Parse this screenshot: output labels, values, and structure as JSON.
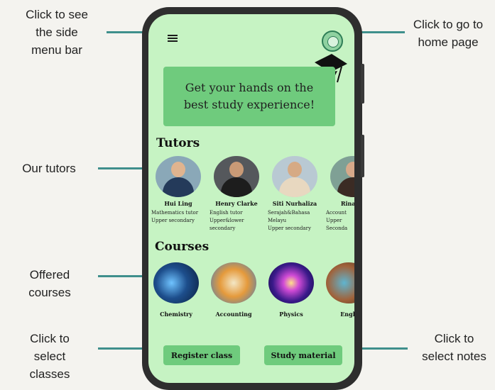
{
  "annotations": {
    "side_menu": "Click to see\nthe side\nmenu bar",
    "home_page": "Click to go to\nhome page",
    "our_tutors": "Our tutors",
    "offered_courses": "Offered\ncourses",
    "select_classes": "Click to\nselect\nclasses",
    "select_notes": "Click to\nselect notes"
  },
  "banner": {
    "text": "Get your hands on the\nbest study experience!"
  },
  "tutors": {
    "title": "Tutors",
    "items": [
      {
        "name": "Hui Ling",
        "desc": "Mathematics tutor\nUpper secondary"
      },
      {
        "name": "Henry Clarke",
        "desc": "English tutor\nUpper&lower\nsecondary"
      },
      {
        "name": "Siti Nurhaliza",
        "desc": "Serajah&Bahasa\nMelayu\nUpper secondary"
      },
      {
        "name": "Rina Se",
        "desc": "Account\nUpper\nSeconda"
      }
    ]
  },
  "courses": {
    "title": "Courses",
    "items": [
      {
        "name": "Chemistry"
      },
      {
        "name": "Accounting"
      },
      {
        "name": "Physics"
      },
      {
        "name": "Engli"
      }
    ]
  },
  "buttons": {
    "register": "Register class",
    "study_material": "Study material"
  },
  "colors": {
    "screen_bg": "#c6f3c3",
    "accent_green": "#6fcb7d",
    "connector": "#3f8f8c"
  },
  "icons": {
    "menu": "hamburger-menu-icon",
    "home": "home-logo-icon",
    "cap": "graduation-cap-icon"
  }
}
